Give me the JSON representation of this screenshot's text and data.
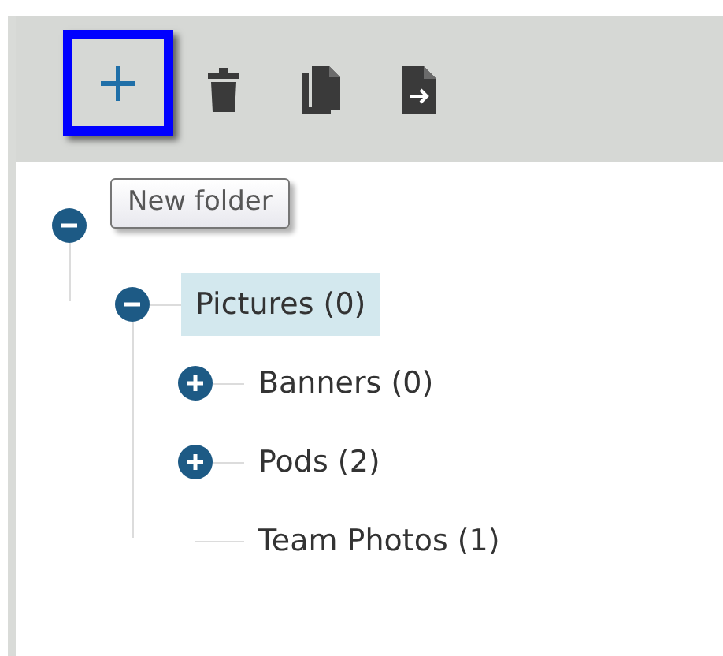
{
  "toolbar": {
    "buttons": [
      {
        "kind": "new",
        "focused": true
      },
      {
        "kind": "delete",
        "focused": false
      },
      {
        "kind": "copy",
        "focused": false
      },
      {
        "kind": "export",
        "focused": false
      }
    ]
  },
  "tooltip": {
    "text": "New folder"
  },
  "tree": {
    "expanded": true,
    "children": [
      {
        "kind": "branch",
        "label": "Pictures (0)",
        "selected": true,
        "expanded": true,
        "children": [
          {
            "kind": "branch",
            "label": "Banners (0)",
            "selected": false,
            "expanded": false
          },
          {
            "kind": "branch",
            "label": "Pods (2)",
            "selected": false,
            "expanded": false
          },
          {
            "kind": "leaf",
            "label": "Team Photos (1)",
            "selected": false
          }
        ]
      }
    ]
  }
}
